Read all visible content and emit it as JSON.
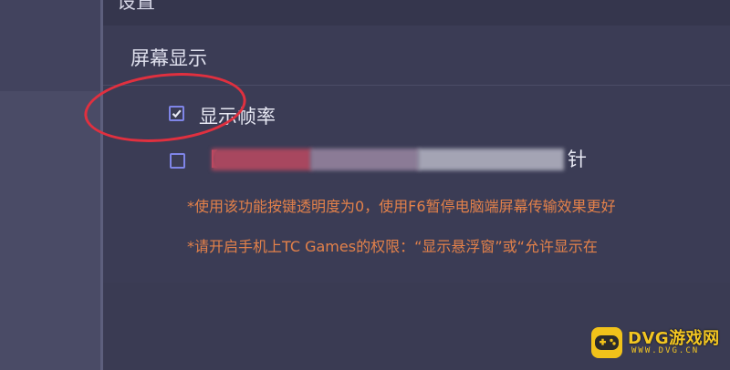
{
  "window": {
    "title": "设置"
  },
  "section": {
    "title": "屏幕显示"
  },
  "options": [
    {
      "label": "显示帧率",
      "checked": true
    },
    {
      "label_start": "【",
      "label_end": "针",
      "checked": false
    }
  ],
  "notes": [
    "*使用该功能按键透明度为0，使用F6暂停电脑端屏幕传输效果更好",
    "*请开启手机上TC Games的权限：“显示悬浮窗”或“允许显示在"
  ],
  "watermark": {
    "brand": "DVG游戏网",
    "site": "WWW.DVG.CN",
    "icon": "gamepad-icon"
  },
  "colors": {
    "accent_checkbox": "#7f85e8",
    "note_text": "#e3814a",
    "annotation_oval": "#e0303f",
    "watermark": "#f3c622"
  }
}
